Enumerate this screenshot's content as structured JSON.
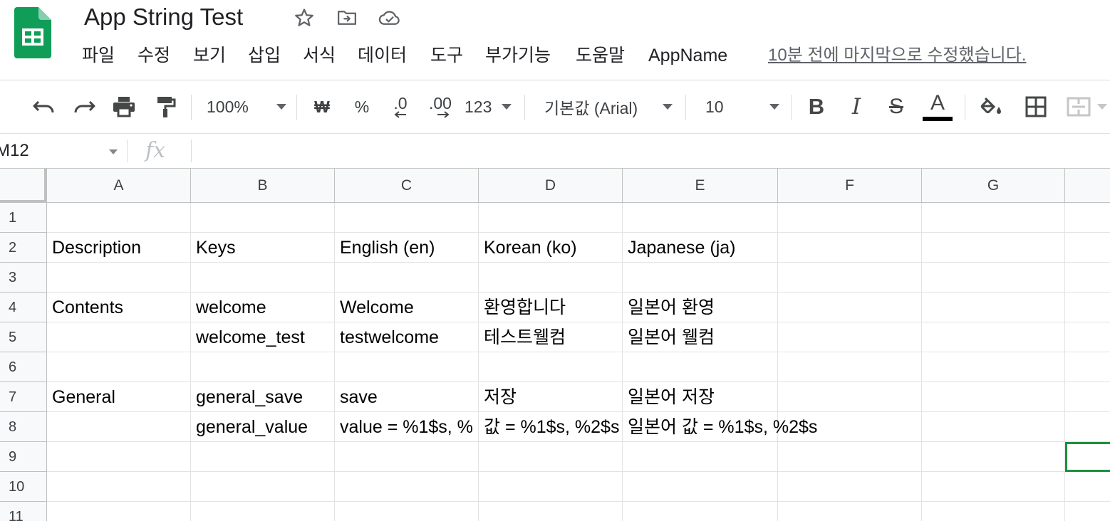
{
  "header": {
    "title": "App String Test",
    "last_edit": "10분 전에 마지막으로 수정했습니다.",
    "icons": [
      "star-icon",
      "move-to-folder-icon",
      "cloud-status-icon"
    ]
  },
  "menu": {
    "items": [
      "파일",
      "수정",
      "보기",
      "삽입",
      "서식",
      "데이터",
      "도구",
      "부가기능",
      "도움말",
      "AppName"
    ]
  },
  "toolbar": {
    "zoom": "100%",
    "currency": "₩",
    "percent": "%",
    "decrease_decimal": ".0",
    "increase_decimal": ".00",
    "more_formats": "123",
    "font": "기본값 (Arial)",
    "font_size": "10",
    "bold": "B",
    "italic": "I",
    "strikethrough": "S",
    "text_color": "A",
    "text_color_value": "#000000"
  },
  "formula_bar": {
    "name_box": "M12",
    "fx": "fx",
    "formula": ""
  },
  "sheet": {
    "columns": [
      "A",
      "B",
      "C",
      "D",
      "E",
      "F",
      "G"
    ],
    "rows": [
      "1",
      "2",
      "3",
      "4",
      "5",
      "6",
      "7",
      "8",
      "9",
      "10",
      "11"
    ],
    "cells": [
      [
        "",
        "",
        "",
        "",
        "",
        "",
        ""
      ],
      [
        "Description",
        "Keys",
        "English (en)",
        "Korean (ko)",
        "Japanese (ja)",
        "",
        ""
      ],
      [
        "",
        "",
        "",
        "",
        "",
        "",
        ""
      ],
      [
        "Contents",
        "welcome",
        "Welcome",
        "환영합니다",
        "일본어 환영",
        "",
        ""
      ],
      [
        "",
        "welcome_test",
        "testwelcome",
        "테스트웰컴",
        "일본어 웰컴",
        "",
        ""
      ],
      [
        "",
        "",
        "",
        "",
        "",
        "",
        ""
      ],
      [
        "General",
        "general_save",
        "save",
        "저장",
        "일본어 저장",
        "",
        ""
      ],
      [
        "",
        "general_value",
        "value = %1$s, %",
        "값 = %1$s, %2$s",
        "일본어 값 = %1$s, %2$s",
        "",
        ""
      ],
      [
        "",
        "",
        "",
        "",
        "",
        "",
        ""
      ],
      [
        "",
        "",
        "",
        "",
        "",
        "",
        ""
      ],
      [
        "",
        "",
        "",
        "",
        "",
        "",
        ""
      ]
    ]
  },
  "colors": {
    "selection": "#1e8e3e",
    "sheets_green": "#0f9d58"
  }
}
